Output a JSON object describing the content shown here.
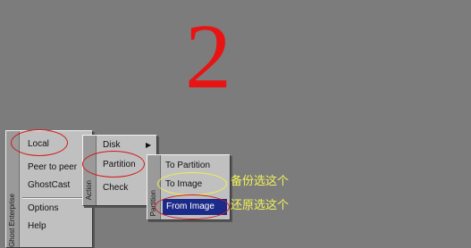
{
  "step": {
    "number": "2"
  },
  "main_menu": {
    "strip_label": "Ghost Enterprise",
    "items": [
      {
        "label": "Local"
      },
      {
        "label": "Peer to peer"
      },
      {
        "label": "GhostCast"
      },
      {
        "label": "Options"
      },
      {
        "label": "Help"
      }
    ]
  },
  "local_menu": {
    "strip_label": "Action",
    "items": [
      {
        "label": "Disk",
        "arrow": "▶"
      },
      {
        "label": "Partition",
        "arrow": "▶"
      },
      {
        "label": "Check",
        "arrow": "▶"
      }
    ]
  },
  "partition_menu": {
    "strip_label": "Partition",
    "items": [
      {
        "label": "To Partition"
      },
      {
        "label": "To Image"
      },
      {
        "label": "From Image"
      }
    ]
  },
  "annotations": {
    "backup": "备份选这个",
    "restore": "还原选这个"
  },
  "colors": {
    "background": "#7c7c7c",
    "menu": "#c0c0c0",
    "highlight": "#1c2a8a",
    "number": "#e81414",
    "circle_red": "#d21a1a",
    "circle_yellow": "#f0f050",
    "note_text": "#f2f25a"
  }
}
